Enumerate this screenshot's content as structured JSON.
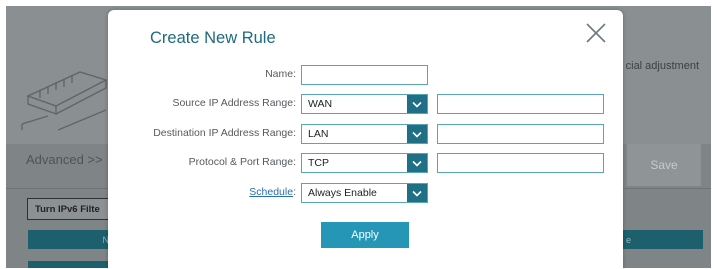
{
  "background": {
    "adjustment_text": "cial adjustment",
    "advanced_text": "Advanced >>",
    "save_label": "Save",
    "turn_ipv6_label": "Turn IPv6 Filte",
    "table_header_left": "Na",
    "table_header_right": "e"
  },
  "modal": {
    "title": "Create New Rule",
    "close_icon": "close-icon",
    "fields": {
      "name": {
        "label": "Name:",
        "value": ""
      },
      "source_ip": {
        "label": "Source IP Address Range:",
        "selected": "WAN",
        "value": ""
      },
      "destination_ip": {
        "label": "Destination IP Address Range:",
        "selected": "LAN",
        "value": ""
      },
      "protocol_port": {
        "label": "Protocol & Port Range:",
        "selected": "TCP",
        "value": ""
      },
      "schedule": {
        "label": "Schedule",
        "colon": ":",
        "selected": "Always Enable"
      }
    },
    "apply_label": "Apply"
  },
  "colors": {
    "accent": "#1d6b7e",
    "button": "#2596b6",
    "dropdown_button": "#1f6f87",
    "input_border": "#5aa4b8",
    "overlay": "#7f8486"
  }
}
